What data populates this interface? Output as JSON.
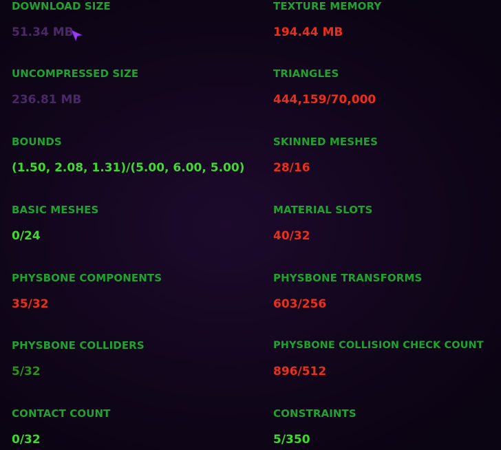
{
  "colors": {
    "label": "#1fa32e",
    "good": "#3ddc2a",
    "medium": "#2f8f1c",
    "bad": "#e8301a",
    "dim": "#4a2a66",
    "cursor": "#9b3df0"
  },
  "stats": {
    "download_size": {
      "label": "DOWNLOAD SIZE",
      "value": "51.34 MB"
    },
    "texture_memory": {
      "label": "TEXTURE MEMORY",
      "value": "194.44 MB"
    },
    "uncompressed_size": {
      "label": "UNCOMPRESSED SIZE",
      "value": "236.81 MB"
    },
    "triangles": {
      "label": "TRIANGLES",
      "value": "444,159/70,000"
    },
    "bounds": {
      "label": "BOUNDS",
      "value": "(1.50, 2.08, 1.31)/(5.00, 6.00, 5.00)"
    },
    "skinned_meshes": {
      "label": "SKINNED MESHES",
      "value": "28/16"
    },
    "basic_meshes": {
      "label": "BASIC MESHES",
      "value": "0/24"
    },
    "material_slots": {
      "label": "MATERIAL SLOTS",
      "value": "40/32"
    },
    "physbone_components": {
      "label": "PHYSBONE COMPONENTS",
      "value": "35/32"
    },
    "physbone_transforms": {
      "label": "PHYSBONE TRANSFORMS",
      "value": "603/256"
    },
    "physbone_colliders": {
      "label": "PHYSBONE COLLIDERS",
      "value": "5/32"
    },
    "physbone_collision_check_count": {
      "label": "PHYSBONE COLLISION CHECK COUNT",
      "value": "896/512"
    },
    "contact_count": {
      "label": "CONTACT COUNT",
      "value": "0/32"
    },
    "constraints": {
      "label": "CONSTRAINTS",
      "value": "5/350"
    }
  },
  "cursor": {
    "icon": "pointer-arrow-icon"
  }
}
